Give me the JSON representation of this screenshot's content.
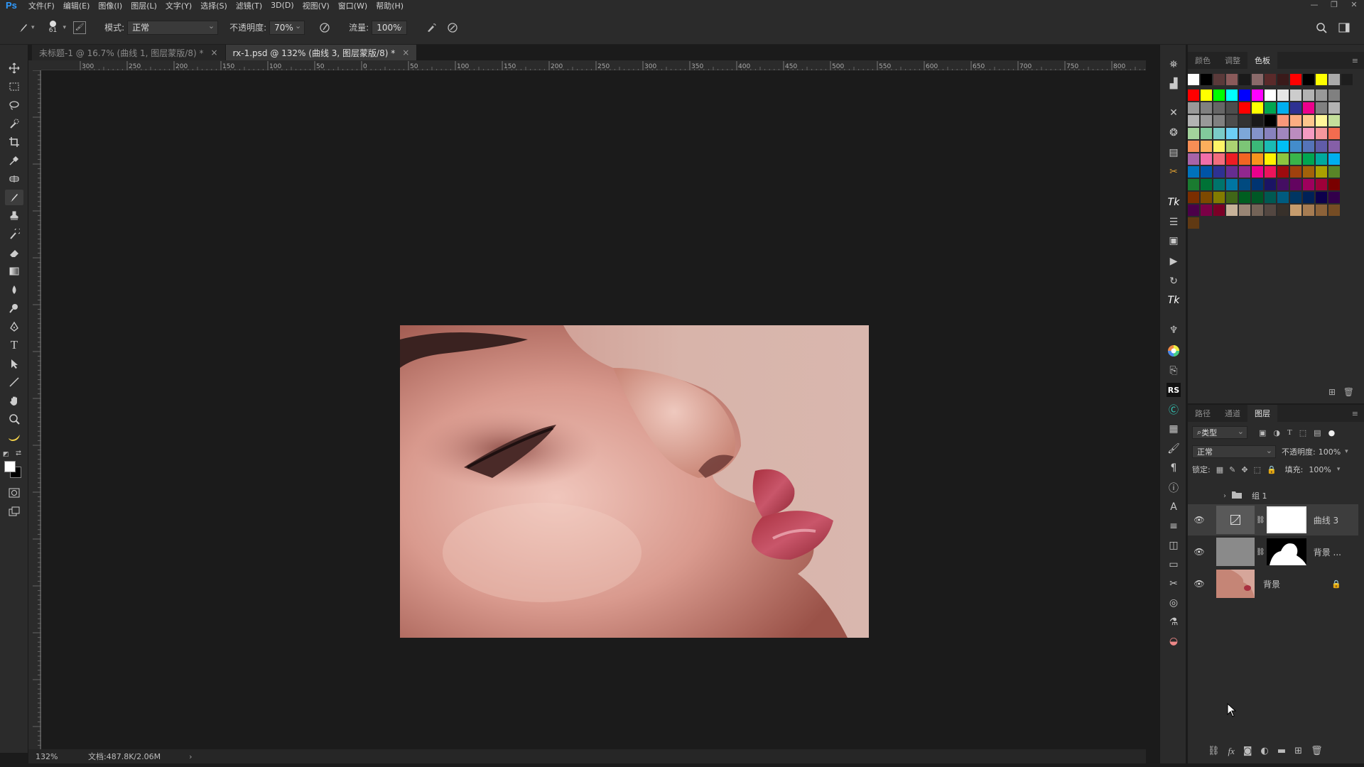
{
  "app": {
    "logo": "Ps"
  },
  "menu": [
    "文件(F)",
    "编辑(E)",
    "图像(I)",
    "图层(L)",
    "文字(Y)",
    "选择(S)",
    "滤镜(T)",
    "3D(D)",
    "视图(V)",
    "窗口(W)",
    "帮助(H)"
  ],
  "window_controls": [
    "—",
    "❐",
    "✕"
  ],
  "options": {
    "brush_size": "61",
    "mode_label": "模式:",
    "mode_value": "正常",
    "opacity_label": "不透明度:",
    "opacity_value": "70%",
    "flow_label": "流量:",
    "flow_value": "100%"
  },
  "tabs": [
    {
      "label": "未标题-1 @ 16.7% (曲线 1, 图层蒙版/8) *",
      "close": "×"
    },
    {
      "label": "rx-1.psd @ 132% (曲线 3, 图层蒙版/8) *",
      "close": "×"
    }
  ],
  "ruler": {
    "h_ticks": [
      "300",
      "250",
      "200",
      "150",
      "100",
      "50",
      "0",
      "50",
      "100",
      "150",
      "200",
      "250",
      "300",
      "350",
      "400",
      "450",
      "500",
      "550",
      "600",
      "650",
      "700",
      "750",
      "800"
    ]
  },
  "status": {
    "zoom": "132%",
    "doc": "文档:487.8K/2.06M",
    "arrow": "›"
  },
  "colors": {
    "accent": "#2f9bff",
    "panel_bg": "#2b2b2b",
    "canvas_bg": "#1b1b1b"
  },
  "swatch_panel": {
    "tabs": [
      "颜色",
      "调整",
      "色板"
    ],
    "active": "色板",
    "rows": [
      [
        "#ffffff",
        "#000000",
        "#5a3a3a",
        "#8a5a5a",
        "#1a1a1a",
        "#8a6a6a",
        "#5a2a2a",
        "#3a1a1a",
        "#ff0000",
        "#000000",
        "#ffff00",
        "#aaaaaa",
        "#1e1e1e"
      ],
      [
        "#ff0000",
        "#ffff00",
        "#00ff00",
        "#00ffff",
        "#0000ff",
        "#ff00ff",
        "#ffffff",
        "#e6e6e6",
        "#cccccc",
        "#b3b3b3",
        "#999999",
        "#808080"
      ],
      [
        "#999999",
        "#808080",
        "#666666",
        "#4d4d4d",
        "#ff0000",
        "#ffff00",
        "#00a651",
        "#00aeef",
        "#2e3192",
        "#ec008c",
        "#808080",
        "#b3b3b3"
      ],
      [
        "#b3b3b3",
        "#999999",
        "#808080",
        "#4d4d4d",
        "#333333",
        "#1a1a1a",
        "#000000",
        "#f7977a",
        "#fbad82",
        "#fdc68c",
        "#fff79a",
        "#c4df9b"
      ],
      [
        "#a3d39c",
        "#82ca9c",
        "#7accc8",
        "#6dcff6",
        "#7da7d8",
        "#8493ca",
        "#8882be",
        "#a186be",
        "#bc8cbf",
        "#f49bc1",
        "#f5989d",
        "#f26c4f"
      ],
      [
        "#f68e55",
        "#fbaf5c",
        "#fff467",
        "#acd372",
        "#7cc576",
        "#3bb878",
        "#1abbb4",
        "#00bff3",
        "#438ccb",
        "#5574b9",
        "#605ca8",
        "#855fa8"
      ],
      [
        "#a763a8",
        "#f06ea9",
        "#f26d7d",
        "#ed1c24",
        "#f26522",
        "#f7941d",
        "#fff200",
        "#8dc63f",
        "#39b54a",
        "#00a651",
        "#00a99d",
        "#00aeef"
      ],
      [
        "#0072bc",
        "#0054a6",
        "#2e3192",
        "#662d91",
        "#92278f",
        "#ec008c",
        "#ed145b",
        "#9e0b0f",
        "#a0410d",
        "#a3620a",
        "#aba000",
        "#598527"
      ],
      [
        "#1a7b30",
        "#007236",
        "#00746b",
        "#0076a3",
        "#004a80",
        "#003471",
        "#1b1464",
        "#440e62",
        "#630460",
        "#9e005d",
        "#9e0039",
        "#790000"
      ],
      [
        "#7b2e00",
        "#7d4900",
        "#827b00",
        "#406618",
        "#005e20",
        "#005826",
        "#005952",
        "#005b7f",
        "#003663",
        "#002157",
        "#0d004c",
        "#32004b"
      ],
      [
        "#4b0049",
        "#7b0046",
        "#7a0026",
        "#c7b299",
        "#998675",
        "#736357",
        "#534741",
        "#37302a",
        "#c69c6d",
        "#a67c52",
        "#8c6239",
        "#754c24"
      ],
      [
        "#603913"
      ]
    ]
  },
  "layers_panel": {
    "tabs": [
      "路径",
      "通道",
      "图层"
    ],
    "active": "图层",
    "filter": "类型",
    "blend": "正常",
    "opacity_label": "不透明度:",
    "opacity_value": "100%",
    "lock_label": "锁定:",
    "fill_label": "填充:",
    "fill_value": "100%",
    "group": "组 1",
    "layers": [
      {
        "name": "曲线 3",
        "visible": true
      },
      {
        "name": "背景 ...",
        "visible": true
      },
      {
        "name": "背景",
        "visible": true
      }
    ]
  }
}
